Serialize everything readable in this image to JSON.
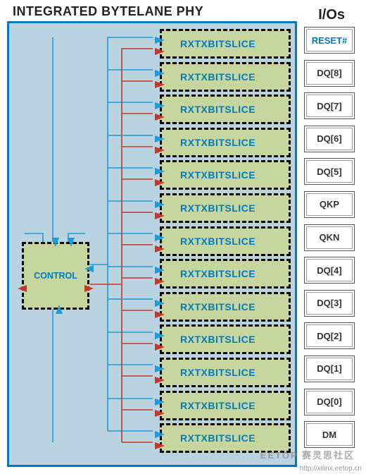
{
  "titles": {
    "phy": "INTEGRATED BYTELANE PHY",
    "ios": "I/Os"
  },
  "control": {
    "label": "CONTROL"
  },
  "slice_label": "RXTXBITSLICE",
  "slice_count": 13,
  "io_pins": [
    {
      "label": "RESET#",
      "class": "reset"
    },
    {
      "label": "DQ[8]",
      "class": ""
    },
    {
      "label": "DQ[7]",
      "class": ""
    },
    {
      "label": "DQ[6]",
      "class": ""
    },
    {
      "label": "DQ[5]",
      "class": ""
    },
    {
      "label": "QKP",
      "class": ""
    },
    {
      "label": "QKN",
      "class": ""
    },
    {
      "label": "DQ[4]",
      "class": ""
    },
    {
      "label": "DQ[3]",
      "class": ""
    },
    {
      "label": "DQ[2]",
      "class": ""
    },
    {
      "label": "DQ[1]",
      "class": ""
    },
    {
      "label": "DQ[0]",
      "class": ""
    },
    {
      "label": "DM",
      "class": ""
    }
  ],
  "watermark_logo": "EETOP 赛灵思社区",
  "watermark_url": "http://xilinx.eetop.cn"
}
